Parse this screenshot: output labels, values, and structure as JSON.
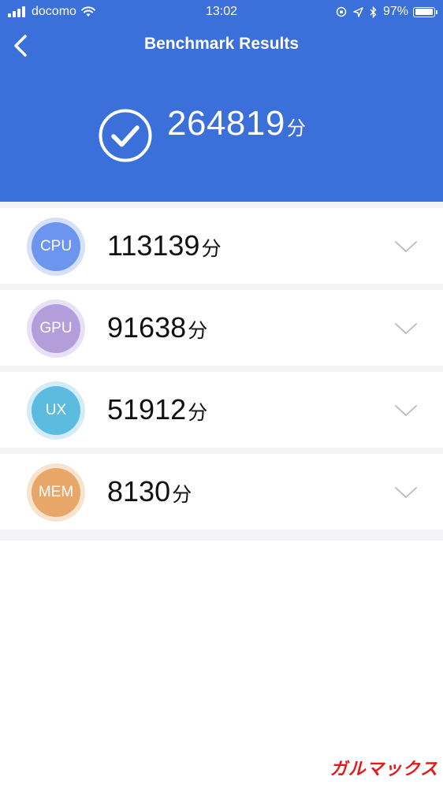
{
  "status_bar": {
    "carrier": "docomo",
    "time": "13:02",
    "battery_percent": "97%",
    "battery_level": 0.97
  },
  "nav": {
    "title": "Benchmark Results"
  },
  "total": {
    "score": "264819",
    "unit": "分"
  },
  "results": [
    {
      "label": "CPU",
      "score": "113139",
      "unit": "分",
      "color": "#6b95ef",
      "ring": "#d5e1fa"
    },
    {
      "label": "GPU",
      "score": "91638",
      "unit": "分",
      "color": "#b39ddb",
      "ring": "#e8e0f4"
    },
    {
      "label": "UX",
      "score": "51912",
      "unit": "分",
      "color": "#5bbce0",
      "ring": "#d3ecf7"
    },
    {
      "label": "MEM",
      "score": "8130",
      "unit": "分",
      "color": "#e8a668",
      "ring": "#f8e3cf"
    }
  ],
  "colors": {
    "header_bg": "#3b6fd9",
    "separator": "#f3f3f5",
    "chevron": "#c2c2c2"
  },
  "watermark": "ガルマックス"
}
